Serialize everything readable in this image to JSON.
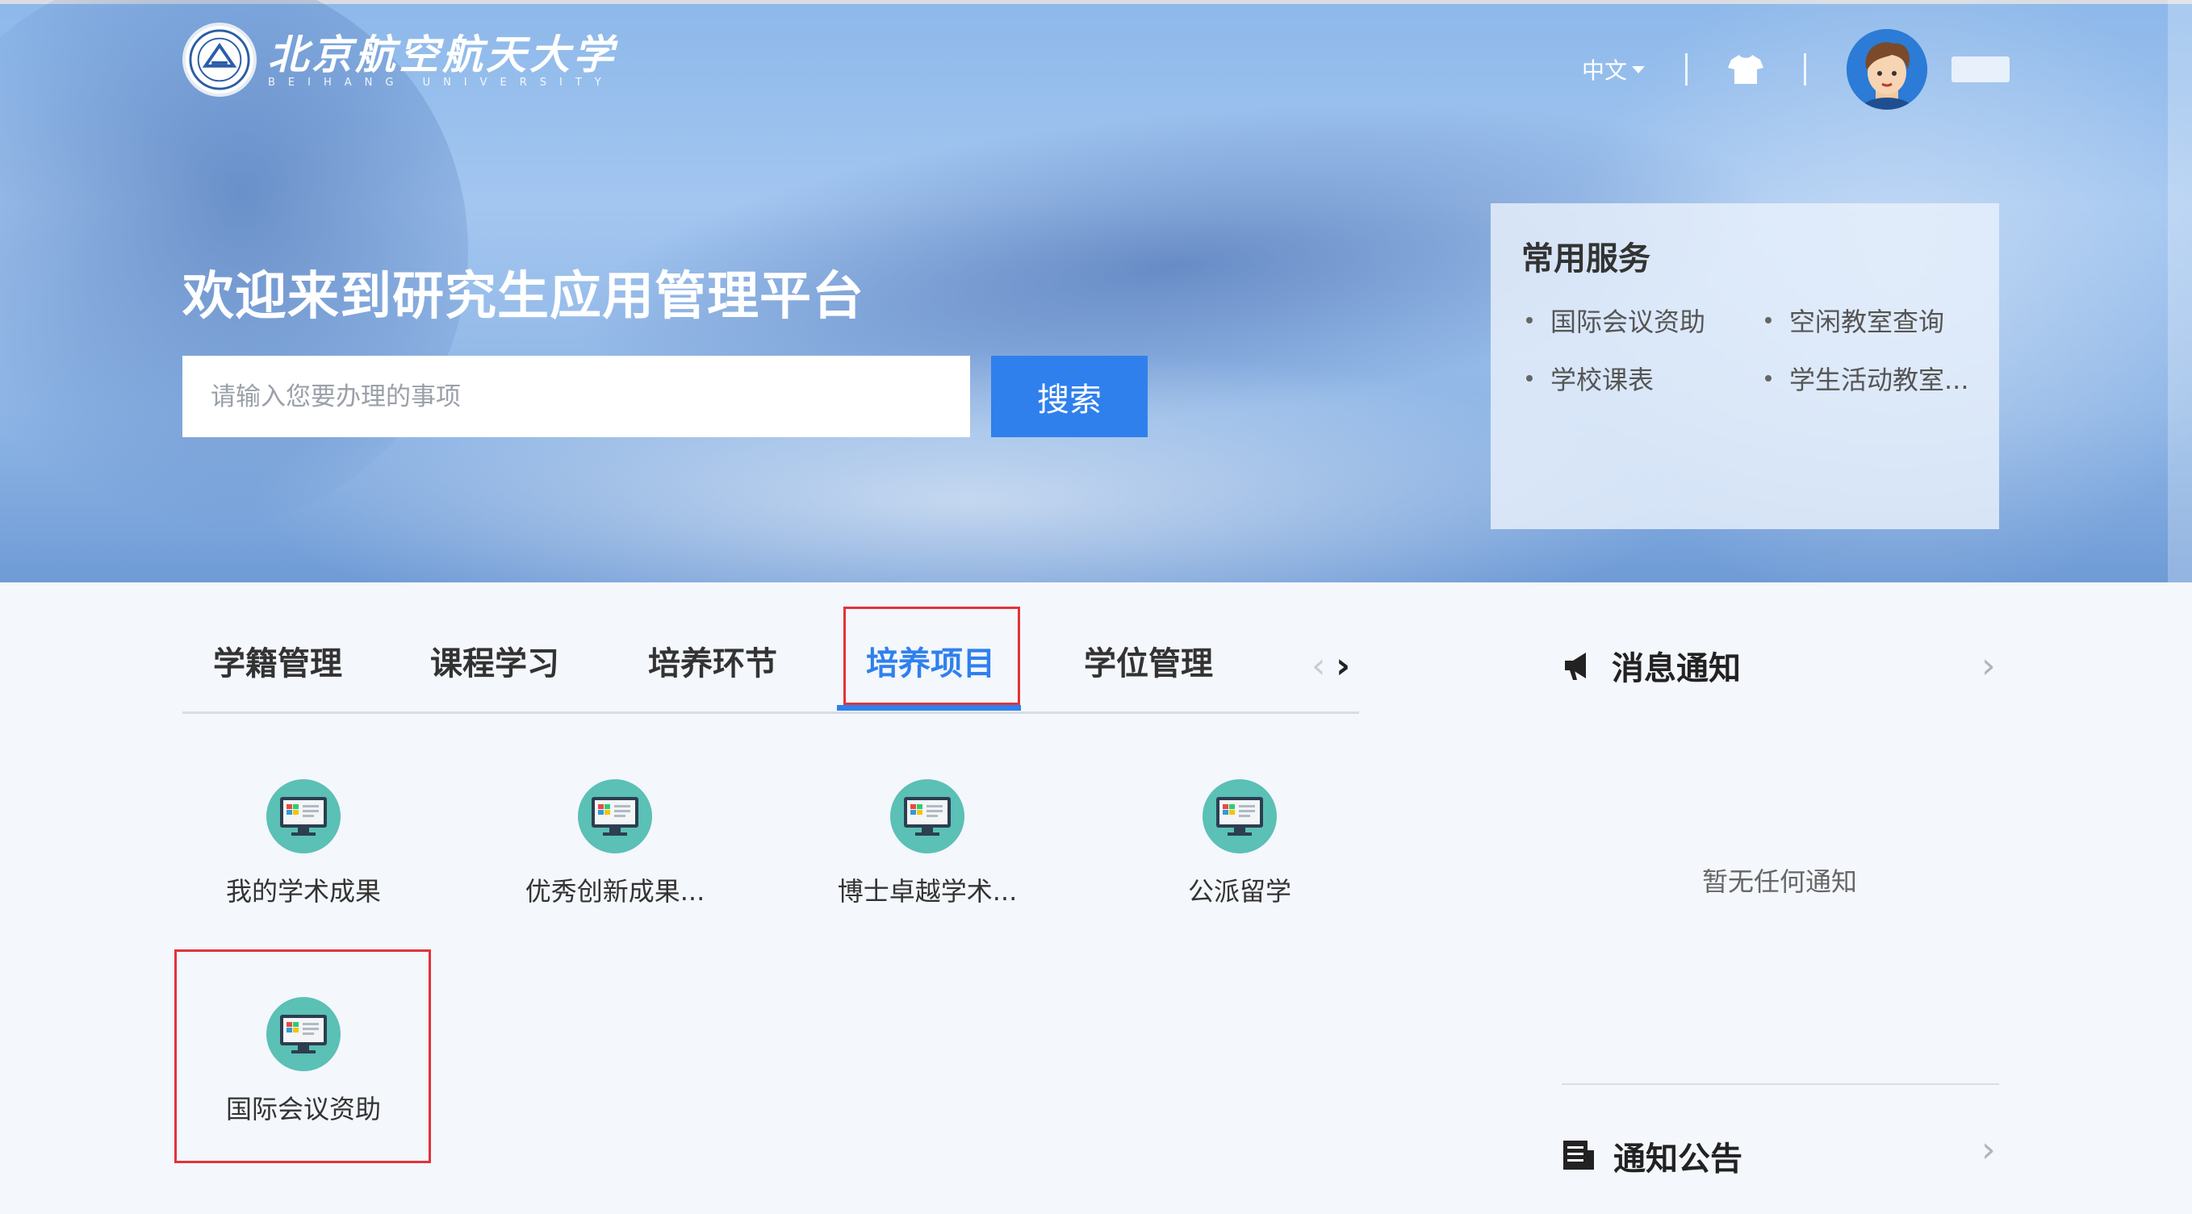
{
  "header": {
    "logo_cn": "北京航空航天大学",
    "logo_en": "BEIHANG UNIVERSITY",
    "language": "中文"
  },
  "hero": {
    "welcome": "欢迎来到研究生应用管理平台",
    "search_placeholder": "请输入您要办理的事项",
    "search_button": "搜索"
  },
  "services": {
    "title": "常用服务",
    "items": [
      "国际会议资助",
      "空闲教室查询",
      "学校课表",
      "学生活动教室..."
    ]
  },
  "tabs": [
    {
      "label": "学籍管理"
    },
    {
      "label": "课程学习"
    },
    {
      "label": "培养环节"
    },
    {
      "label": "培养项目",
      "active": true
    },
    {
      "label": "学位管理"
    }
  ],
  "apps": [
    {
      "label": "我的学术成果"
    },
    {
      "label": "优秀创新成果..."
    },
    {
      "label": "博士卓越学术..."
    },
    {
      "label": "公派留学"
    },
    {
      "label": "国际会议资助"
    }
  ],
  "messages": {
    "title": "消息通知",
    "empty_text": "暂无任何通知"
  },
  "announcements": {
    "title": "通知公告"
  },
  "colors": {
    "accent": "#2f80ed",
    "highlight_box": "#e2323a",
    "app_icon_bg": "#5bc0b5"
  }
}
